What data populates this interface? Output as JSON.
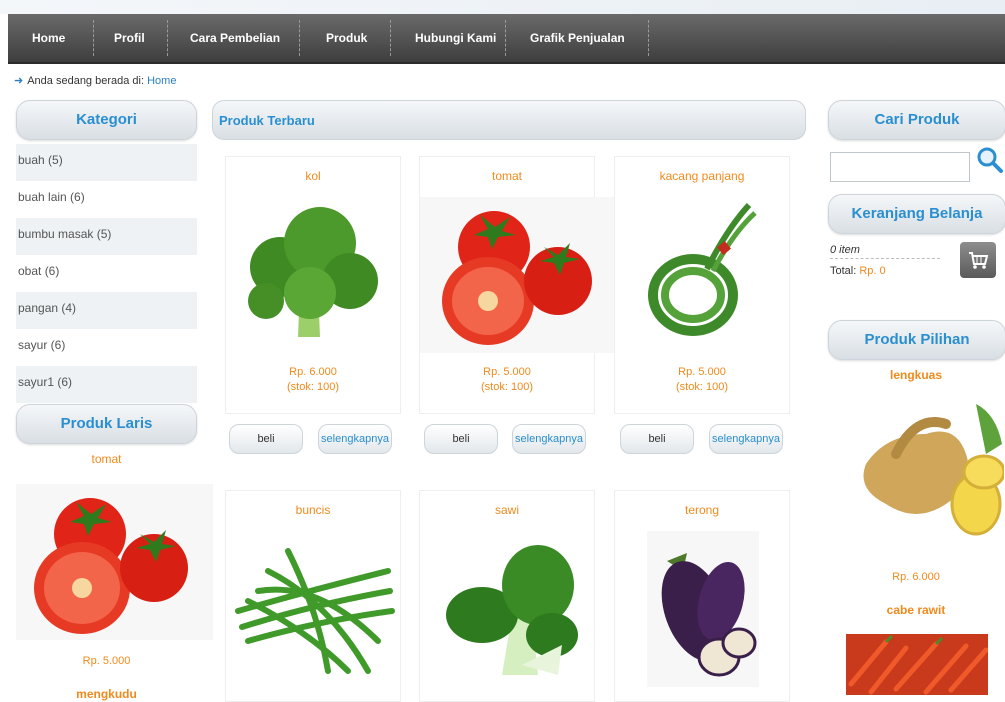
{
  "nav": {
    "items": [
      "Home",
      "Profil",
      "Cara Pembelian",
      "Produk",
      "Hubungi Kami",
      "Grafik Penjualan"
    ]
  },
  "breadcrumb": {
    "prefix": "Anda sedang berada di:",
    "link": "Home"
  },
  "left": {
    "kategori_title": "Kategori",
    "categories": [
      "buah (5)",
      "buah lain (6)",
      "bumbu masak (5)",
      "obat (6)",
      "pangan (4)",
      "sayur (6)",
      "sayur1 (6)"
    ],
    "laris_title": "Produk Laris",
    "laris_name": "tomat",
    "laris_price": "Rp. 5.000",
    "laris_next": "mengkudu"
  },
  "center": {
    "title": "Produk Terbaru",
    "products": [
      {
        "name": "kol",
        "price": "Rp. 6.000",
        "stock": "(stok: 100)"
      },
      {
        "name": "tomat",
        "price": "Rp. 5.000",
        "stock": "(stok: 100)"
      },
      {
        "name": "kacang panjang",
        "price": "Rp. 5.000",
        "stock": "(stok: 100)"
      },
      {
        "name": "buncis",
        "price": "",
        "stock": ""
      },
      {
        "name": "sawi",
        "price": "",
        "stock": ""
      },
      {
        "name": "terong",
        "price": "",
        "stock": ""
      }
    ],
    "buy_label": "beli",
    "detail_label": "selengkapnya"
  },
  "right": {
    "search_title": "Cari Produk",
    "search_value": "",
    "cart_title": "Keranjang Belanja",
    "cart_items": "0 item",
    "cart_total_label": "Total:",
    "cart_total_value": "Rp. 0",
    "pilihan_title": "Produk Pilihan",
    "pilihan_name": "lengkuas",
    "pilihan_price": "Rp. 6.000",
    "pilihan_next": "cabe rawit"
  },
  "colors": {
    "accent_blue": "#2a8fd0",
    "price_orange": "#f08a1c",
    "nav_dark": "#4a4a4a"
  },
  "icons": [
    "search-icon",
    "cart-icon",
    "arrow-icon"
  ]
}
